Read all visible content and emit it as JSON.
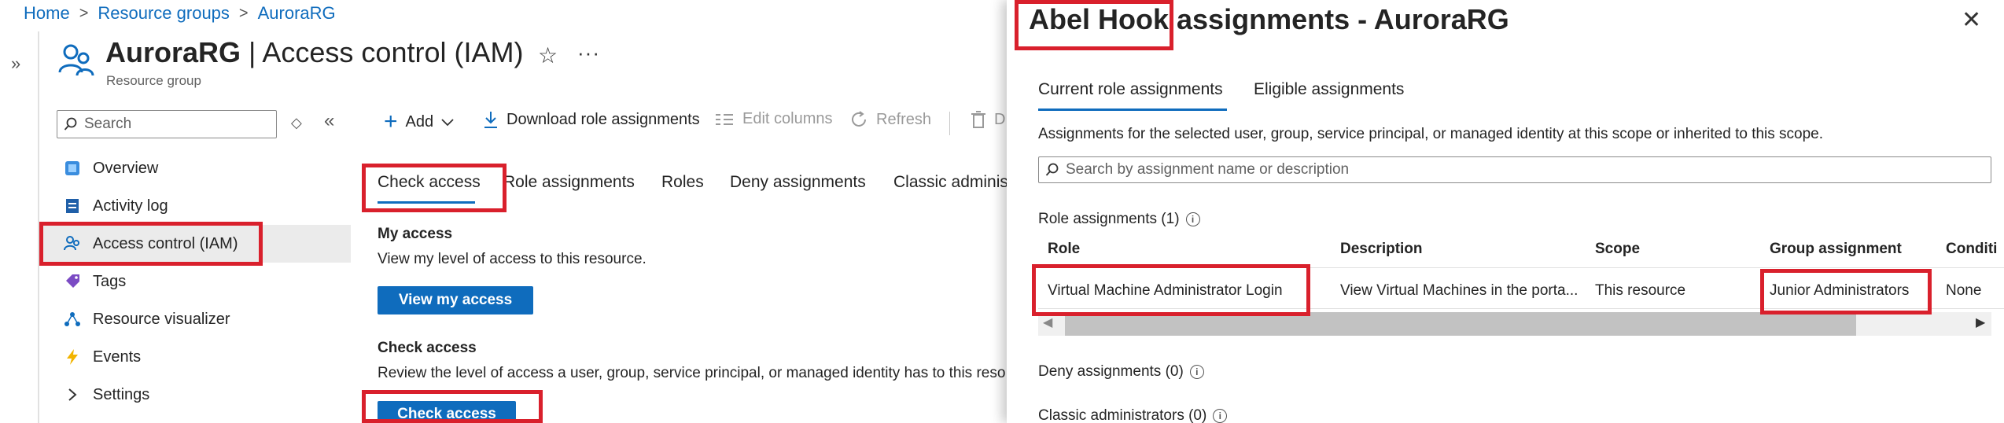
{
  "breadcrumb": {
    "home": "Home",
    "resource_groups": "Resource groups",
    "current": "AuroraRG",
    "sep": ">"
  },
  "header": {
    "title_name": "AuroraRG",
    "title_rest": " | Access control (IAM)",
    "subtitle": "Resource group",
    "fav_glyph": "☆",
    "more_glyph": "···",
    "expand_glyph": "»"
  },
  "menu": {
    "search_placeholder": "Search",
    "items": [
      {
        "label": "Overview",
        "icon": "overview-icon"
      },
      {
        "label": "Activity log",
        "icon": "activity-log-icon"
      },
      {
        "label": "Access control (IAM)",
        "icon": "iam-icon",
        "selected": true
      },
      {
        "label": "Tags",
        "icon": "tag-icon"
      },
      {
        "label": "Resource visualizer",
        "icon": "visualizer-icon"
      },
      {
        "label": "Events",
        "icon": "events-icon"
      },
      {
        "label": "Settings",
        "icon": "chevron-right-icon"
      }
    ]
  },
  "toolbar": {
    "add": "Add",
    "download": "Download role assignments",
    "edit_columns": "Edit columns",
    "refresh": "Refresh",
    "delete_fragment": "D"
  },
  "tabs": {
    "check_access": "Check access",
    "role_assignments": "Role assignments",
    "roles": "Roles",
    "deny_assignments": "Deny assignments",
    "classic_admins": "Classic administr"
  },
  "content": {
    "my_access_heading": "My access",
    "my_access_desc": "View my level of access to this resource.",
    "view_my_access_btn": "View my access",
    "check_access_heading": "Check access",
    "check_access_desc": "Review the level of access a user, group, service principal, or managed identity has to this reso",
    "check_access_btn": "Check access"
  },
  "panel": {
    "title": "Abel Hook assignments - AuroraRG",
    "close_glyph": "✕",
    "tabs": {
      "current": "Current role assignments",
      "eligible": "Eligible assignments"
    },
    "description": "Assignments for the selected user, group, service principal, or managed identity at this scope or inherited to this scope.",
    "search_placeholder": "Search by assignment name or description",
    "role_assignments_label": "Role assignments (1)",
    "columns": {
      "role": "Role",
      "description": "Description",
      "scope": "Scope",
      "group": "Group assignment",
      "condition": "Conditi"
    },
    "row": {
      "role": "Virtual Machine Administrator Login",
      "description": "View Virtual Machines in the porta...",
      "scope": "This resource",
      "group": "Junior Administrators",
      "condition": "None"
    },
    "deny_label": "Deny assignments (0)",
    "classic_label": "Classic administrators (0)"
  },
  "colors": {
    "accent": "#0f6cbd",
    "highlight": "#d9202c"
  }
}
